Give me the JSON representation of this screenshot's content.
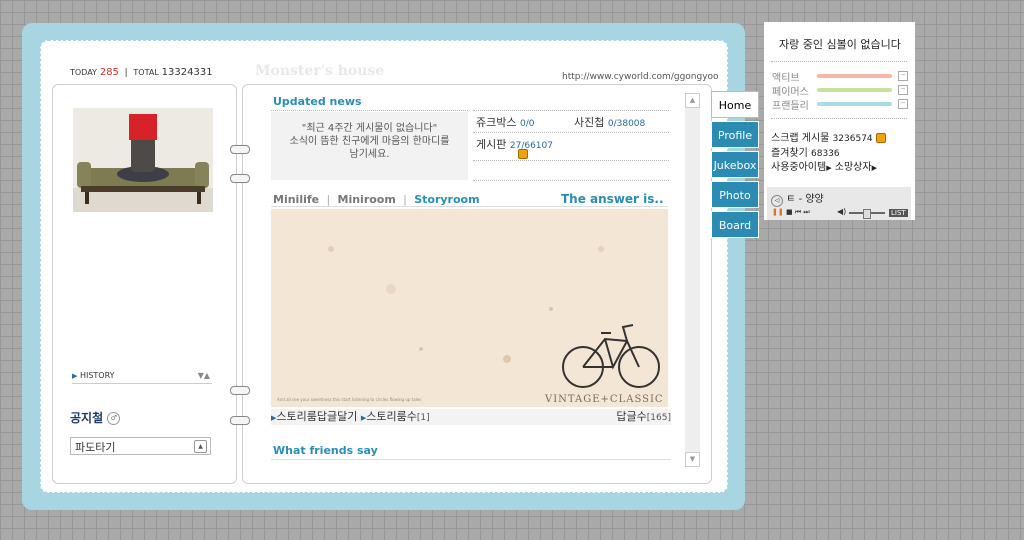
{
  "header": {
    "today_label": "TODAY",
    "today_count": "285",
    "total_label": "TOTAL",
    "total_count": "13324331",
    "home_title": "Monster's house",
    "url": "http://www.cyworld.com/ggongyoo"
  },
  "left": {
    "history_label": "HISTORY",
    "notice_title": "공지철",
    "search_value": "파도타기"
  },
  "updated_news": {
    "title": "Updated news",
    "empty_line1": "\"최근 4주간 게시물이 없습니다\"",
    "empty_line2": "소식이 뜸한 친구에게 마음의 한마디를",
    "empty_line3": "남기세요.",
    "stats": [
      {
        "label": "쥬크박스",
        "value": "0/0"
      },
      {
        "label": "사진첩",
        "value": "0/38008"
      },
      {
        "label": "게시판",
        "value": "27/66107"
      }
    ]
  },
  "mini_nav": {
    "items": [
      "Minilife",
      "Miniroom",
      "Storyroom"
    ],
    "active": "Storyroom",
    "answer_title": "The answer is.."
  },
  "story_image": {
    "brand_text": "VINTAGE+CLASSIC",
    "small_text": "And all see your sweetness this start listening to circles flowing up tales"
  },
  "story_footer": {
    "reply_link": "스토리룸답글달기",
    "count_link": "스토리룸수",
    "count_value": "[1]",
    "reply_count_label": "답글수",
    "reply_count_value": "[165]"
  },
  "friends_say": {
    "title": "What friends say"
  },
  "tabs": [
    {
      "label": "Home",
      "active": true
    },
    {
      "label": "Profile",
      "active": false
    },
    {
      "label": "Jukebox",
      "active": false
    },
    {
      "label": "Photo",
      "active": false
    },
    {
      "label": "Board",
      "active": false
    }
  ],
  "side": {
    "title": "자랑 중인 심볼이 없습니다",
    "bars": [
      {
        "label": "액티브",
        "color": "#f7b6a7"
      },
      {
        "label": "페이머스",
        "color": "#c9e19b"
      },
      {
        "label": "프랜들리",
        "color": "#a8dce9"
      }
    ],
    "scrap_label": "스크랩 게시물",
    "scrap_value": "3236574",
    "fav_label": "즐겨찾기",
    "fav_value": "68336",
    "items_label": "사용중아이템",
    "wish_label": "소망상자"
  },
  "player": {
    "track": "ㅌ - 양양",
    "list_label": "LIST"
  }
}
